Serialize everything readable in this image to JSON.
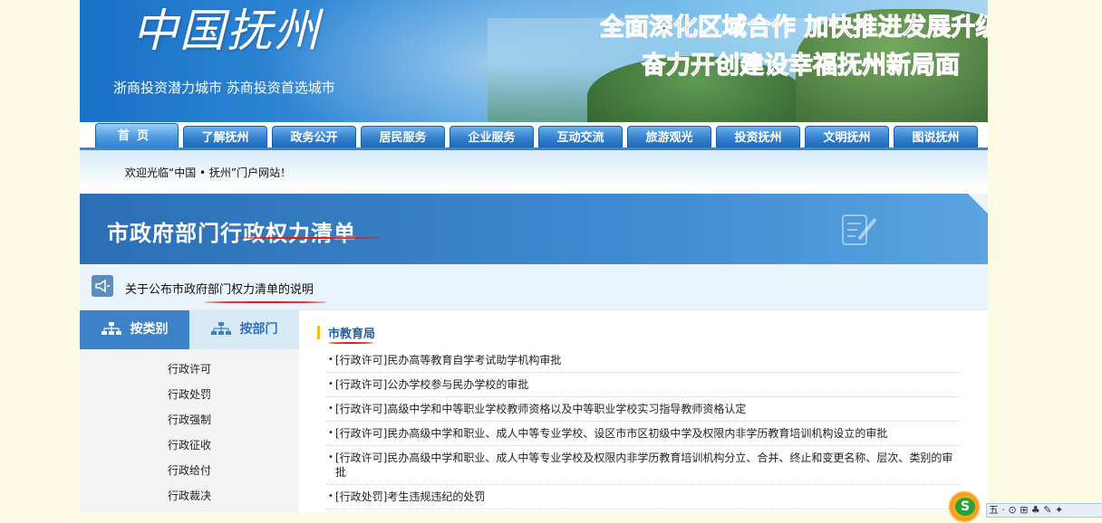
{
  "banner": {
    "logo": "中国抚州",
    "tagline": "浙商投资潜力城市   苏商投资首选城市",
    "slogan1": "全面深化区域合作  加快推进发展升级",
    "slogan2": "奋力开创建设幸福抚州新局面"
  },
  "nav": {
    "tabs": [
      "首页",
      "了解抚州",
      "政务公开",
      "居民服务",
      "企业服务",
      "互动交流",
      "旅游观光",
      "投资抚州",
      "文明抚州",
      "图说抚州"
    ]
  },
  "welcome": "欢迎光临“中国 • 抚州”门户网站！",
  "section": {
    "title": "市政府部门行政权力清单",
    "notice": "关于公布市政府部门权力清单的说明"
  },
  "side": {
    "tab_category": "按类别",
    "tab_department": "按部门",
    "items": [
      "行政许可",
      "行政处罚",
      "行政强制",
      "行政征收",
      "行政给付",
      "行政裁决"
    ]
  },
  "main": {
    "department": "市教育局",
    "items": [
      "[行政许可]民办高等教育自学考试助学机构审批",
      "[行政许可]公办学校参与民办学校的审批",
      "[行政许可]高级中学和中等职业学校教师资格以及中等职业学校实习指导教师资格认定",
      "[行政许可]民办高级中学和职业、成人中等专业学校、设区市市区初级中学及权限内非学历教育培训机构设立的审批",
      "[行政许可]民办高级中学和职业、成人中等专业学校及权限内非学历教育培训机构分立、合并、终止和变更名称、层次、类别的审批",
      "[行政处罚]考生违规违纪的处罚"
    ]
  },
  "taskbar": {
    "badge": "S",
    "text": "五 · ⊙ ⊞ ♣ ✎ ✦"
  },
  "colors": {
    "accent": "#3b82c8",
    "slogan": "#d11414",
    "underline": "#e01818",
    "dept_bar": "#f2c312"
  }
}
